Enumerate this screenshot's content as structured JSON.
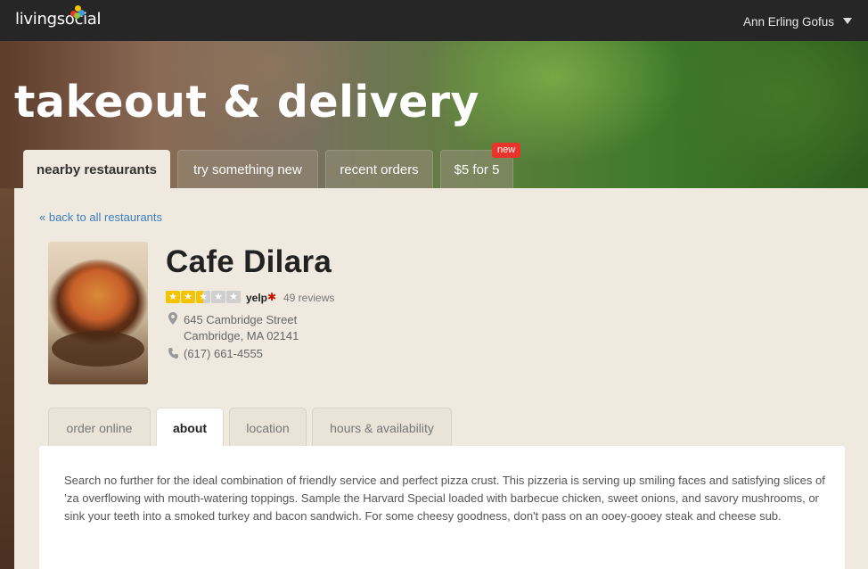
{
  "header": {
    "logo_text": "livingsocial",
    "user_name": "Ann Erling Gofus"
  },
  "hero": {
    "title": "takeout & delivery",
    "tabs": [
      {
        "label": "nearby restaurants",
        "active": true
      },
      {
        "label": "try something new",
        "active": false
      },
      {
        "label": "recent orders",
        "active": false
      },
      {
        "label": "$5 for 5",
        "active": false,
        "badge": "new"
      }
    ]
  },
  "restaurant": {
    "back_link": "« back to all restaurants",
    "name": "Cafe Dilara",
    "rating": 2.5,
    "rating_max": 5,
    "rating_source": "yelp",
    "reviews": "49 reviews",
    "address_line1": "645 Cambridge Street",
    "address_line2": "Cambridge, MA 02141",
    "phone": "(617) 661-4555"
  },
  "detail_tabs": [
    {
      "label": "order online",
      "active": false
    },
    {
      "label": "about",
      "active": true
    },
    {
      "label": "location",
      "active": false
    },
    {
      "label": "hours & availability",
      "active": false
    }
  ],
  "about_text": "Search no further for the ideal combination of friendly service and perfect pizza crust. This pizzeria is serving up smiling faces and satisfying slices of ’za overflowing with mouth-watering toppings. Sample the Harvard Special loaded with barbecue chicken, sweet onions, and savory mushrooms, or sink your teeth into a smoked turkey and bacon sandwich. For some cheesy goodness, don't pass on an ooey-gooey steak and cheese sub.",
  "colors": {
    "topbar": "#262626",
    "link": "#3a7fc4",
    "badge": "#e8342b",
    "star": "#f2c400",
    "yelp": "#c41200"
  }
}
